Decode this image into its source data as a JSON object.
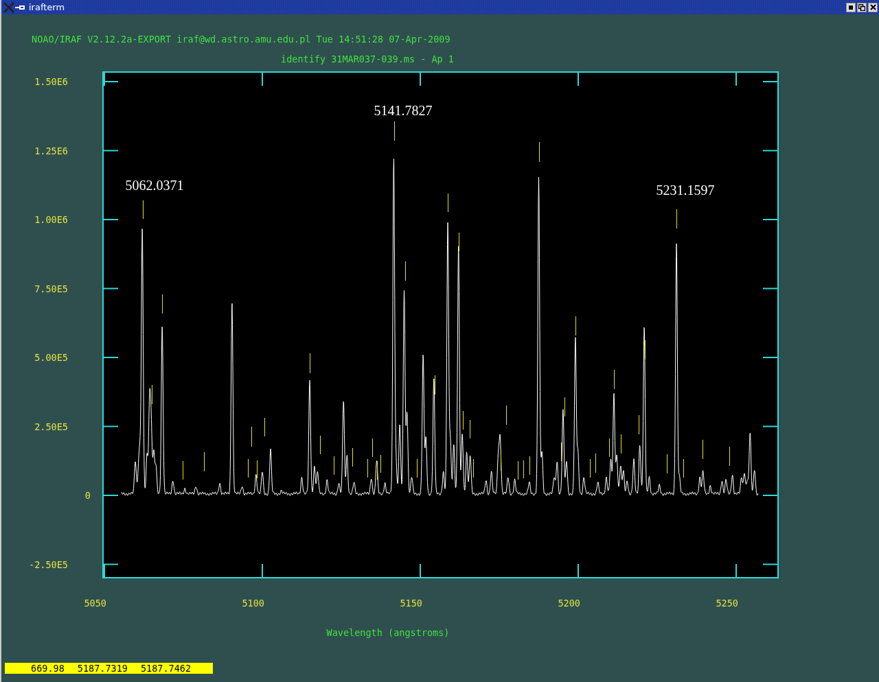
{
  "window": {
    "title": "irafterm"
  },
  "header": "NOAO/IRAF V2.12.2a-EXPORT iraf@wd.astro.amu.edu.pl Tue 14:51:28 07-Apr-2009",
  "plot": {
    "title": "identify 31MAR037-039.ms - Ap 1",
    "yticks": [
      "1.50E6",
      "1.25E6",
      "1.00E6",
      "7.50E5",
      "5.00E5",
      "2.50E5",
      "0",
      "-2.50E5"
    ],
    "xticks": [
      "5050",
      "5100",
      "5150",
      "5200",
      "5250"
    ],
    "xlabel": "Wavelength (angstroms)",
    "annotations": [
      "5062.0371",
      "5141.7827",
      "5231.1597"
    ]
  },
  "status_bar": [
    "669.98",
    "5187.7319",
    "5187.7462"
  ]
}
